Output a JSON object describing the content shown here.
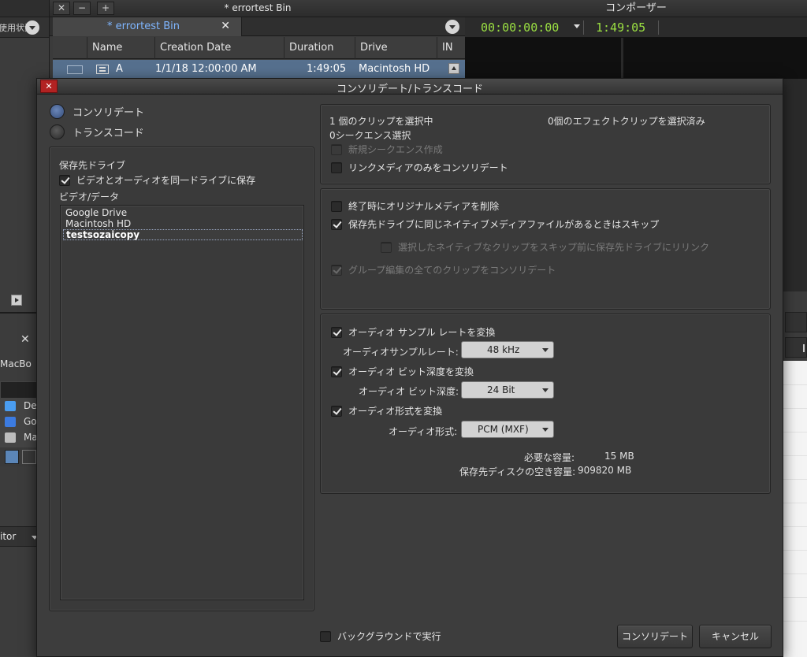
{
  "background": {
    "left_panel": {
      "tab_label": "使用状況",
      "device_label": "MacBo",
      "list_items": [
        {
          "label": "De",
          "icon": "folder-icon",
          "color": "#4a9df0"
        },
        {
          "label": "Go",
          "icon": "google-drive-icon",
          "color": "#3c7be0"
        },
        {
          "label": "Ma",
          "icon": "hard-drive-icon",
          "color": "#bcbcbc"
        }
      ],
      "monitor_label": "itor"
    },
    "bin_window": {
      "title": "* errortest Bin",
      "tab_label": "* errortest Bin",
      "columns": [
        "Name",
        "Creation Date",
        "Duration",
        "Drive",
        "IN"
      ],
      "row": {
        "name": "A",
        "creation_date": "1/1/18 12:00:00 AM",
        "duration": "1:49:05",
        "drive": "Macintosh HD"
      }
    },
    "composer": {
      "title": "コンポーザー",
      "timecode_left": "00:00:00:00",
      "timecode_right": "1:49:05"
    }
  },
  "dialog": {
    "title": "コンソリデート/トランスコード",
    "mode_options": [
      {
        "label": "コンソリデート",
        "selected": true
      },
      {
        "label": "トランスコード",
        "selected": false
      }
    ],
    "target_drive": {
      "heading": "保存先ドライブ",
      "same_drive_checkbox": {
        "label": "ビデオとオーディオを同一ドライブに保存",
        "checked": true
      },
      "list_heading": "ビデオ/データ",
      "drives": [
        "Google Drive",
        "Macintosh HD",
        "testsozaicopy"
      ],
      "selected_drive": "testsozaicopy"
    },
    "selection_info": {
      "clips_selected": "1 個のクリップを選択中",
      "effect_clips_selected": "0個のエフェクトクリップを選択済み",
      "sequences_selected": "0シークエンス選択",
      "new_sequence": {
        "label": "新規シークエンス作成",
        "checked": false,
        "enabled": false
      },
      "linked_media_only": {
        "label": "リンクメディアのみをコンソリデート",
        "checked": false,
        "enabled": true
      }
    },
    "media_options": {
      "delete_original": {
        "label": "終了時にオリジナルメディアを削除",
        "checked": false,
        "enabled": true
      },
      "skip_native": {
        "label": "保存先ドライブに同じネイティブメディアファイルがあるときはスキップ",
        "checked": true,
        "enabled": true
      },
      "relink_native": {
        "label": "選択したネイティブなクリップをスキップ前に保存先ドライブにリリンク",
        "checked": false,
        "enabled": false
      },
      "group_clips": {
        "label": "グループ編集の全てのクリップをコンソリデート",
        "checked": true,
        "enabled": false
      }
    },
    "audio": {
      "convert_sample_rate": {
        "label": "オーディオ サンプル レートを変換",
        "checked": true
      },
      "sample_rate_label": "オーディオサンプルレート:",
      "sample_rate_value": "48 kHz",
      "convert_bit_depth": {
        "label": "オーディオ ビット深度を変換",
        "checked": true
      },
      "bit_depth_label": "オーディオ ビット深度:",
      "bit_depth_value": "24 Bit",
      "convert_format": {
        "label": "オーディオ形式を変換",
        "checked": true
      },
      "format_label": "オーディオ形式:",
      "format_value": "PCM (MXF)",
      "required_space_label": "必要な容量:",
      "required_space_value": "15 MB",
      "free_space_label": "保存先ディスクの空き容量:",
      "free_space_value": "909820 MB"
    },
    "background_run": {
      "label": "バックグラウンドで実行",
      "checked": false
    },
    "buttons": {
      "consolidate": "コンソリデート",
      "cancel": "キャンセル"
    }
  }
}
